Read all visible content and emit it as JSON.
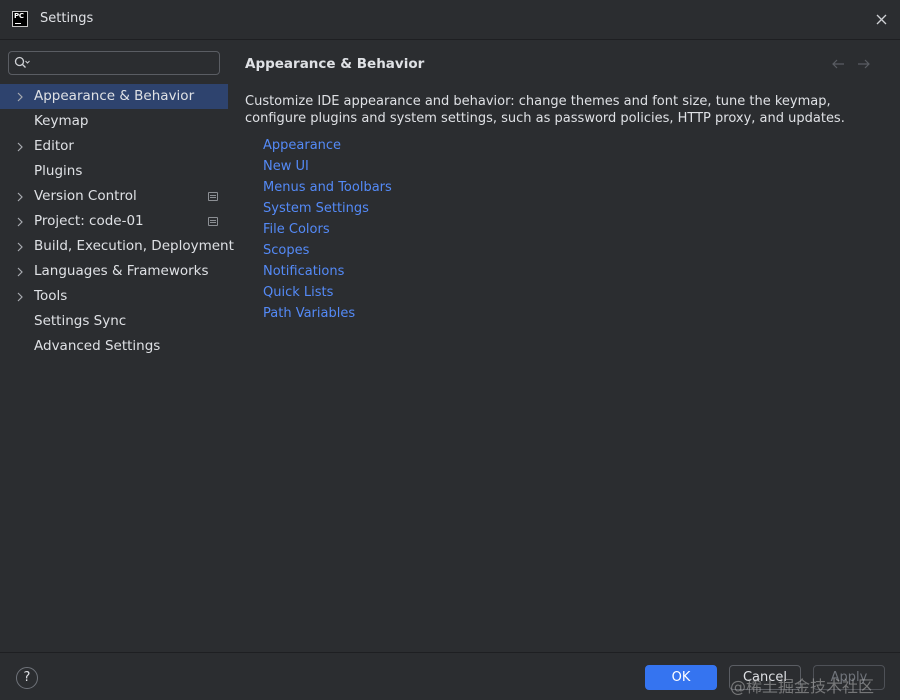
{
  "window": {
    "app_logo_text": "PC",
    "title": "Settings"
  },
  "search": {
    "value": "",
    "placeholder": ""
  },
  "sidebar": {
    "items": [
      {
        "label": "Appearance & Behavior",
        "expandable": true,
        "selected": true
      },
      {
        "label": "Keymap",
        "expandable": false
      },
      {
        "label": "Editor",
        "expandable": true
      },
      {
        "label": "Plugins",
        "expandable": false
      },
      {
        "label": "Version Control",
        "expandable": true,
        "project_icon": true
      },
      {
        "label": "Project: code-01",
        "expandable": true,
        "project_icon": true
      },
      {
        "label": "Build, Execution, Deployment",
        "expandable": true
      },
      {
        "label": "Languages & Frameworks",
        "expandable": true
      },
      {
        "label": "Tools",
        "expandable": true
      },
      {
        "label": "Settings Sync",
        "expandable": false
      },
      {
        "label": "Advanced Settings",
        "expandable": false
      }
    ]
  },
  "main": {
    "title": "Appearance & Behavior",
    "description": "Customize IDE appearance and behavior: change themes and font size, tune the keymap, configure plugins and system settings, such as password policies, HTTP proxy, and updates.",
    "links": [
      "Appearance",
      "New UI",
      "Menus and Toolbars",
      "System Settings",
      "File Colors",
      "Scopes",
      "Notifications",
      "Quick Lists",
      "Path Variables"
    ]
  },
  "footer": {
    "help_label": "?",
    "ok_label": "OK",
    "cancel_label": "Cancel",
    "apply_label": "Apply"
  },
  "watermark": "@稀土掘金技术社区",
  "colors": {
    "background": "#2b2d30",
    "selection": "#2e436e",
    "link": "#548af7",
    "primary_button": "#3574f0",
    "text": "#dfe1e5"
  },
  "icons": {
    "search": "search-icon",
    "close": "close-icon",
    "chevron": "chevron-right-icon",
    "project": "project-level-icon",
    "back": "arrow-left-icon",
    "forward": "arrow-right-icon"
  }
}
